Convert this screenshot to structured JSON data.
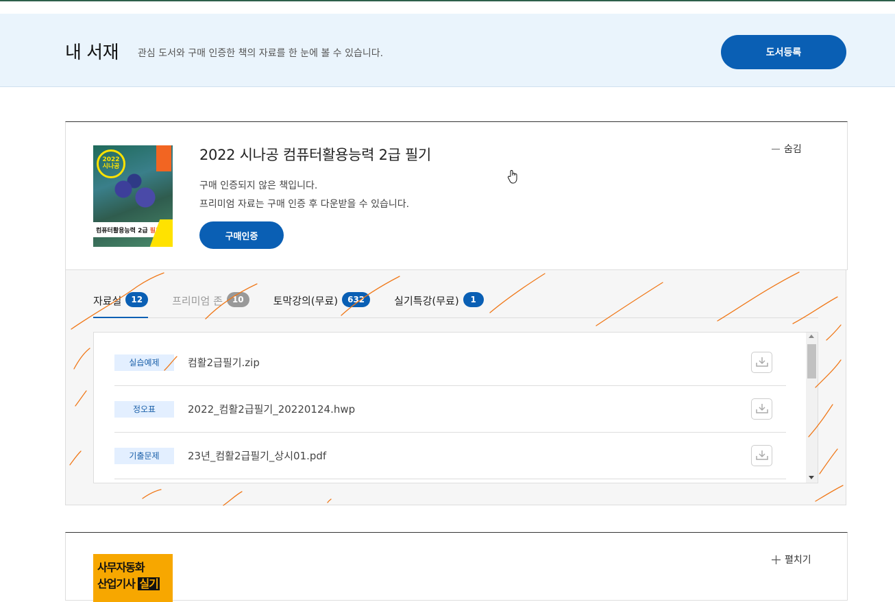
{
  "header": {
    "title": "내 서재",
    "description": "관심 도서와 구매 인증한 책의 자료를 한 눈에 볼 수 있습니다.",
    "register_label": "도서등록"
  },
  "book1": {
    "title": "2022 시나공 컴퓨터활용능력 2급 필기",
    "message1": "구매 인증되지 않은 책입니다.",
    "message2": "프리미엄 자료는 구매 인증 후 다운받을 수 있습니다.",
    "verify_label": "구매인증",
    "toggle_label": "숨김",
    "cover": {
      "badge": "2022 시나공",
      "band_prefix": "컴퓨터활용능력 2급 ",
      "band_highlight": "필기"
    },
    "tabs": [
      {
        "label": "자료실",
        "count": "12"
      },
      {
        "label": "프리미엄 존",
        "count": "10"
      },
      {
        "label": "토막강의(무료)",
        "count": "632"
      },
      {
        "label": "실기특강(무료)",
        "count": "1"
      }
    ],
    "files": [
      {
        "tag": "실습예제",
        "name": "컴활2급필기.zip"
      },
      {
        "tag": "정오표",
        "name": "2022_컴활2급필기_20220124.hwp"
      },
      {
        "tag": "기출문제",
        "name": "23년_컴활2급필기_상시01.pdf"
      }
    ]
  },
  "book2": {
    "toggle_label": "펼치기",
    "cover": {
      "line1": "사무자동화",
      "line2_prefix": "산업기사 ",
      "line2_highlight": "실기"
    }
  },
  "colors": {
    "accent": "#0a5fb4",
    "header_bg": "#eaf4fc",
    "tag_bg": "#e3efff",
    "annotation": "#f07818"
  }
}
